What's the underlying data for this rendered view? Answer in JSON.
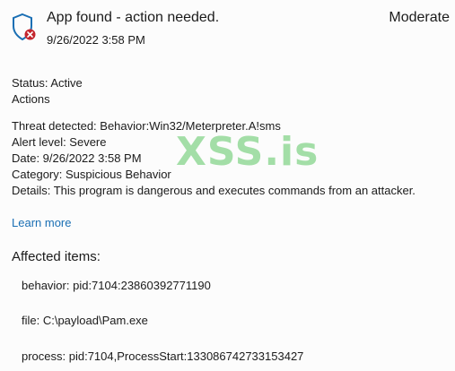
{
  "header": {
    "title": "App found - action needed.",
    "severity": "Moderate",
    "timestamp": "9/26/2022 3:58 PM",
    "icon": "shield-alert-icon"
  },
  "status_line": "Status:  Active",
  "actions_label": "Actions",
  "details": {
    "threat": "Threat detected:  Behavior:Win32/Meterpreter.A!sms",
    "alert_level": "Alert level:  Severe",
    "date": "Date:  9/26/2022 3:58 PM",
    "category": "Category:  Suspicious Behavior",
    "details_text": "Details:  This program is dangerous and executes commands from an attacker."
  },
  "learn_more": "Learn more",
  "affected": {
    "heading": "Affected items:",
    "items": [
      "behavior: pid:7104:23860392771190",
      "file: C:\\payload\\Pam.exe",
      "process: pid:7104,ProcessStart:133086742733153427"
    ]
  },
  "watermark": "XSS.is",
  "colors": {
    "link": "#1a6fb4",
    "shield": "#1a6fb4",
    "alert_badge": "#c4262e",
    "watermark": "#5ac460"
  }
}
